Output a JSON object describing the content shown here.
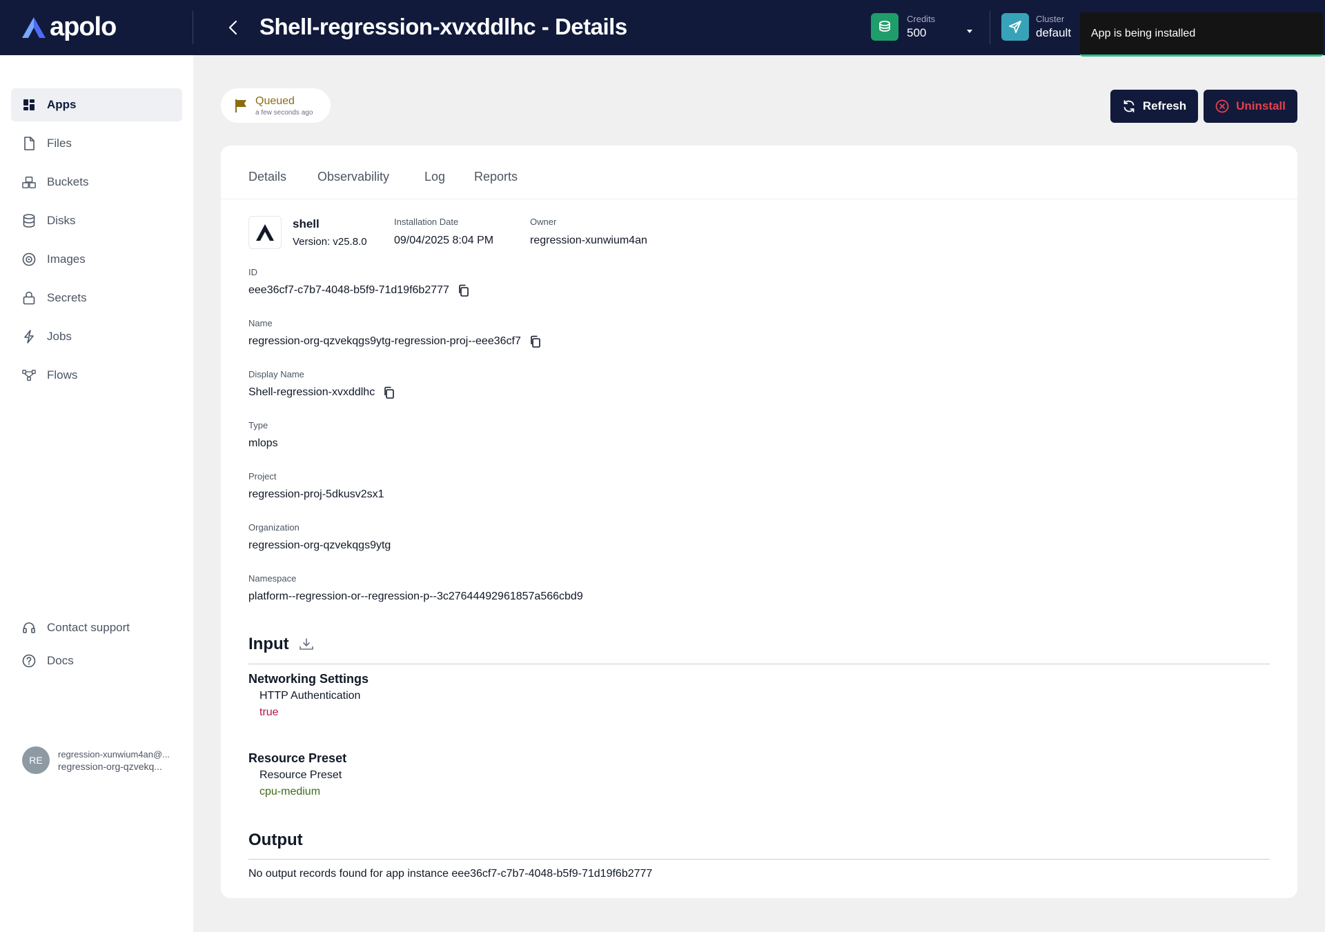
{
  "header": {
    "logo_text": "apolo",
    "title": "Shell-regression-xvxddlhc - Details",
    "credits_label": "Credits",
    "credits_value": "500",
    "cluster_label": "Cluster",
    "cluster_value": "default",
    "toast": "App is being installed"
  },
  "sidebar": {
    "items": [
      {
        "label": "Apps",
        "icon": "apps-icon"
      },
      {
        "label": "Files",
        "icon": "file-icon"
      },
      {
        "label": "Buckets",
        "icon": "bucket-icon"
      },
      {
        "label": "Disks",
        "icon": "disk-icon"
      },
      {
        "label": "Images",
        "icon": "image-icon"
      },
      {
        "label": "Secrets",
        "icon": "lock-icon"
      },
      {
        "label": "Jobs",
        "icon": "bolt-icon"
      },
      {
        "label": "Flows",
        "icon": "flow-icon"
      }
    ],
    "support": "Contact support",
    "docs": "Docs",
    "user": {
      "initials": "RE",
      "email": "regression-xunwium4an@...",
      "org": "regression-org-qzvekq..."
    }
  },
  "status": {
    "label": "Queued",
    "time": "a few seconds ago"
  },
  "actions": {
    "refresh": "Refresh",
    "uninstall": "Uninstall"
  },
  "tabs": [
    "Details",
    "Observability",
    "Log",
    "Reports"
  ],
  "app": {
    "name": "shell",
    "version": "Version: v25.8.0",
    "installation_label": "Installation Date",
    "installation_value": "09/04/2025 8:04 PM",
    "owner_label": "Owner",
    "owner_value": "regression-xunwium4an"
  },
  "fields": {
    "id_label": "ID",
    "id_value": "eee36cf7-c7b7-4048-b5f9-71d19f6b2777",
    "name_label": "Name",
    "name_value": "regression-org-qzvekqgs9ytg-regression-proj--eee36cf7",
    "display_label": "Display Name",
    "display_value": "Shell-regression-xvxddlhc",
    "type_label": "Type",
    "type_value": "mlops",
    "project_label": "Project",
    "project_value": "regression-proj-5dkusv2sx1",
    "org_label": "Organization",
    "org_value": "regression-org-qzvekqgs9ytg",
    "ns_label": "Namespace",
    "ns_value": "platform--regression-or--regression-p--3c27644492961857a566cbd9"
  },
  "input": {
    "title": "Input",
    "networking_title": "Networking Settings",
    "http_auth_label": "HTTP Authentication",
    "http_auth_value": "true",
    "preset_title": "Resource Preset",
    "preset_label": "Resource Preset",
    "preset_value": "cpu-medium"
  },
  "output": {
    "title": "Output",
    "message": "No output records found for app instance eee36cf7-c7b7-4048-b5f9-71d19f6b2777"
  },
  "colors": {
    "topbar": "#111a3b",
    "credits_icon": "#1f9d6a",
    "cluster_icon": "#38a3b8",
    "uninstall_text": "#e5404e",
    "queued": "#8a6d12"
  }
}
